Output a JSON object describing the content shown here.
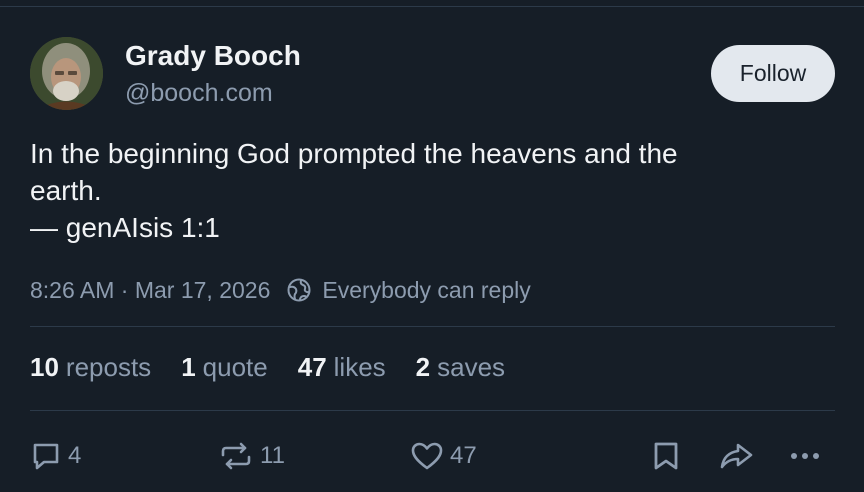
{
  "author": {
    "display_name": "Grady Booch",
    "handle": "@booch.com"
  },
  "follow_label": "Follow",
  "post": {
    "lines": [
      "In the beginning God prompted the heavens and the",
      "earth.",
      "— genAIsis 1:1"
    ]
  },
  "meta": {
    "timestamp": "8:26 AM · Mar 17, 2026",
    "reply_setting": "Everybody can reply"
  },
  "stats": {
    "reposts": {
      "num": "10",
      "label": "reposts"
    },
    "quotes": {
      "num": "1",
      "label": "quote"
    },
    "likes": {
      "num": "47",
      "label": "likes"
    },
    "saves": {
      "num": "2",
      "label": "saves"
    }
  },
  "actions": {
    "reply_count": "4",
    "repost_count": "11",
    "like_count": "47"
  },
  "icons": {
    "reply": "reply-icon",
    "repost": "repost-icon",
    "like": "heart-icon",
    "save": "bookmark-icon",
    "share": "share-icon",
    "more": "more-icon",
    "reply_setting": "globe-icon"
  },
  "colors": {
    "background": "#161e27",
    "text": "#f1f3f5",
    "muted": "#8d9caf",
    "follow_bg": "#e3e8ee",
    "divider": "#2c3a49"
  }
}
